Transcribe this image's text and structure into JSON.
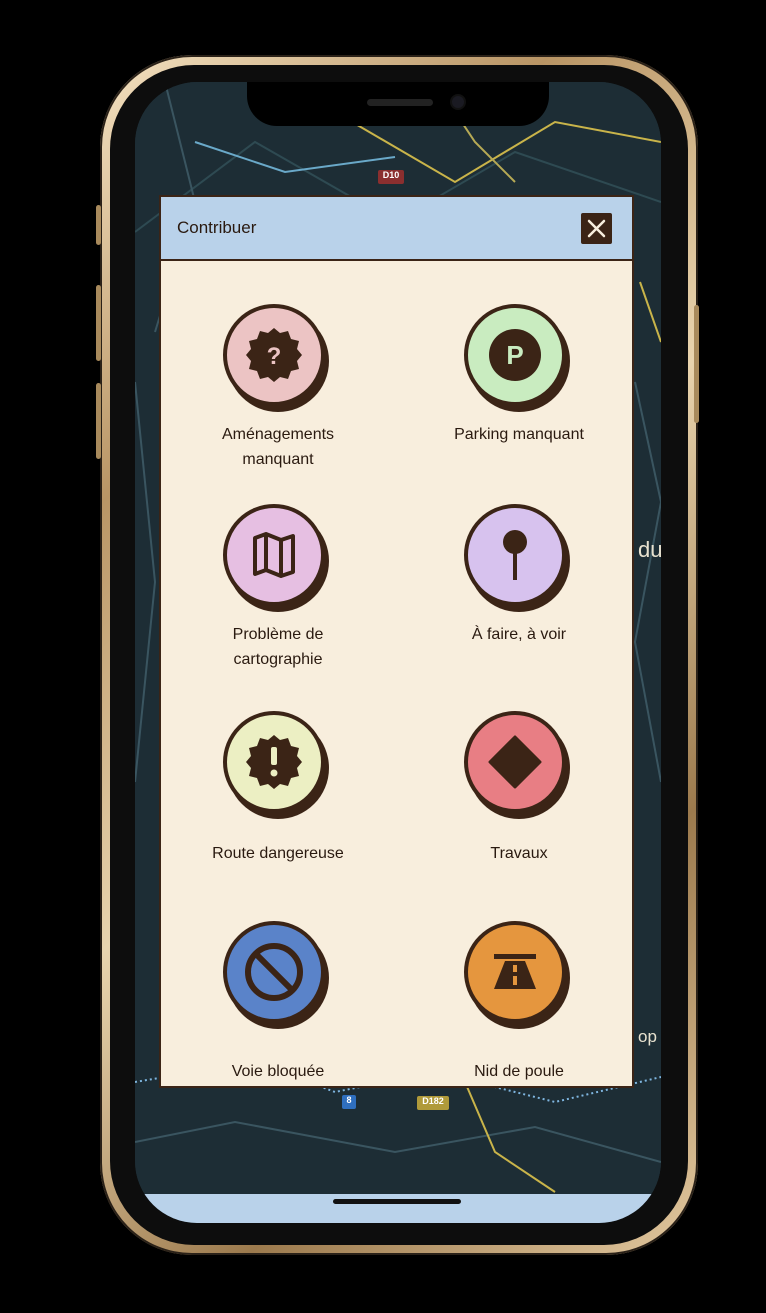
{
  "modal": {
    "title": "Contribuer",
    "close_icon": "close-icon"
  },
  "items": [
    {
      "label_l1": "Aménagements",
      "label_l2": "manquant",
      "color": "#ecc4c4",
      "icon": "question-badge-icon"
    },
    {
      "label_l1": "Parking manquant",
      "label_l2": "",
      "color": "#c9ecc0",
      "icon": "parking-icon"
    },
    {
      "label_l1": "Problème de",
      "label_l2": "cartographie",
      "color": "#e6bfe2",
      "icon": "map-icon"
    },
    {
      "label_l1": "À faire, à voir",
      "label_l2": "",
      "color": "#d7c2ee",
      "icon": "pin-icon"
    },
    {
      "label_l1": "Route dangereuse",
      "label_l2": "",
      "color": "#ecefc3",
      "icon": "exclamation-badge-icon"
    },
    {
      "label_l1": "Travaux",
      "label_l2": "",
      "color": "#e87e84",
      "icon": "diamond-icon"
    },
    {
      "label_l1": "Voie bloquée",
      "label_l2": "",
      "color": "#5a83c9",
      "icon": "no-entry-icon"
    },
    {
      "label_l1": "Nid de poule",
      "label_l2": "",
      "color": "#e5963e",
      "icon": "road-icon"
    }
  ],
  "map": {
    "route_labels": [
      "D10",
      "8",
      "D182"
    ],
    "edge_text": [
      "du",
      "op"
    ]
  },
  "colors": {
    "header_bg": "#b9d2ea",
    "modal_bg": "#f8eedd",
    "outline": "#3b2416"
  }
}
